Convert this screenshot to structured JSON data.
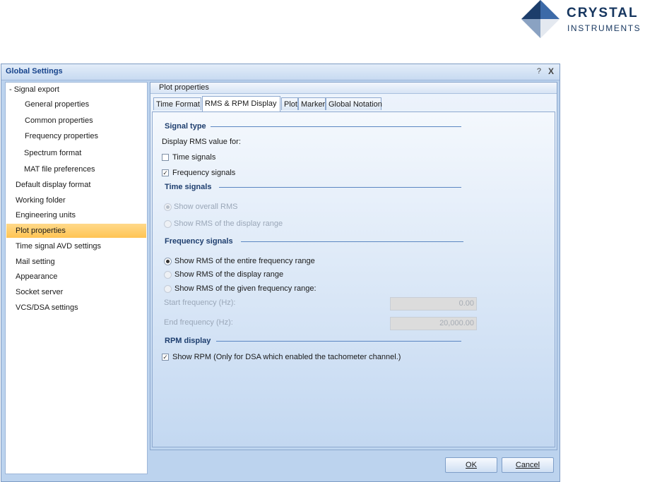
{
  "logo": {
    "line1": "CRYSTAL",
    "line2": "INSTRUMENTS"
  },
  "window": {
    "title": "Global Settings",
    "help": "?",
    "close": "X"
  },
  "sidebar": {
    "items": [
      {
        "label": "- Signal export"
      },
      {
        "label": "General properties"
      },
      {
        "label": "Common properties"
      },
      {
        "label": "Frequency properties"
      },
      {
        "label": "Spectrum format"
      },
      {
        "label": "MAT file preferences"
      },
      {
        "label": "Default display format"
      },
      {
        "label": "Working folder"
      },
      {
        "label": "Engineering units"
      },
      {
        "label": "Plot properties"
      },
      {
        "label": "Time signal AVD settings"
      },
      {
        "label": "Mail setting"
      },
      {
        "label": "Appearance"
      },
      {
        "label": "Socket server"
      },
      {
        "label": "VCS/DSA settings"
      }
    ],
    "selected": "Plot properties"
  },
  "panel": {
    "header": "Plot properties"
  },
  "tabs": [
    {
      "label": "Time Format"
    },
    {
      "label": "RMS & RPM Display"
    },
    {
      "label": "Plot"
    },
    {
      "label": "Marker"
    },
    {
      "label": "Global Notation"
    }
  ],
  "active_tab": "RMS & RPM Display",
  "signal_type": {
    "title": "Signal type",
    "prompt": "Display RMS value for:",
    "time_signals": {
      "label": "Time signals",
      "checked": false
    },
    "frequency_signals": {
      "label": "Frequency signals",
      "checked": true
    }
  },
  "time_signals": {
    "title": "Time signals",
    "option1": "Show overall RMS",
    "option2": "Show RMS of the display range",
    "selected": "Show overall RMS"
  },
  "frequency_signals": {
    "title": "Frequency signals",
    "option1": "Show RMS of the entire frequency range",
    "option2": "Show RMS of the display range",
    "option3": "Show RMS of the given frequency range:",
    "selected": "Show RMS of the entire frequency range",
    "start_label": "Start frequency (Hz):",
    "start_value": "0.00",
    "end_label": "End frequency (Hz):",
    "end_value": "20,000.00"
  },
  "rpm_display": {
    "title": "RPM display",
    "show_rpm": {
      "label": "Show RPM (Only for DSA which enabled the tachometer channel.)",
      "checked": true
    }
  },
  "buttons": {
    "ok": "OK",
    "cancel": "Cancel"
  },
  "colors": {
    "selection": "#ffc453",
    "section_title": "#1e3e6e",
    "dialog_bg": "#bcd3ee"
  }
}
